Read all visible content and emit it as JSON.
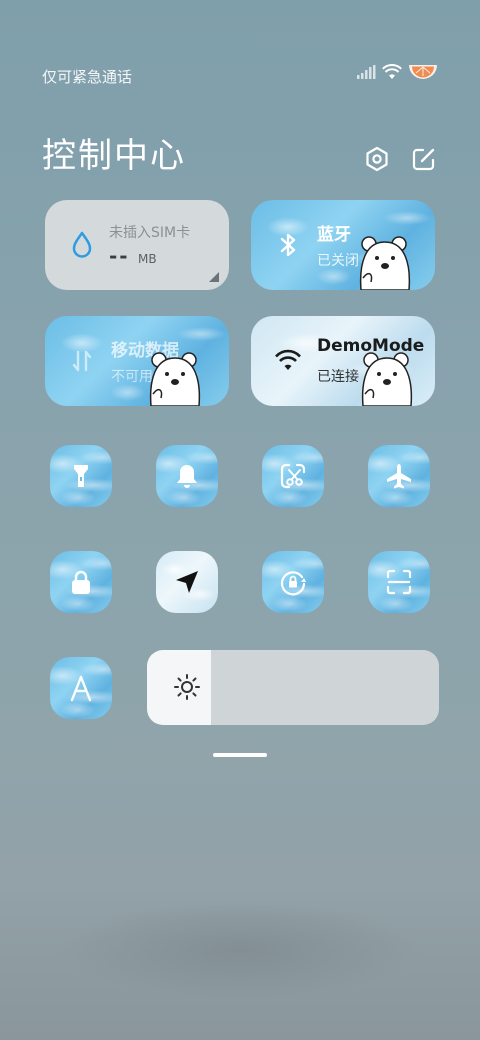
{
  "status": {
    "carrier_text": "仅可紧急通话",
    "icons": [
      "signal-icon",
      "wifi-icon",
      "battery-icon"
    ]
  },
  "header": {
    "title": "控制中心",
    "icons": [
      "settings-icon",
      "edit-icon"
    ]
  },
  "tiles": {
    "data_usage": {
      "label": "未插入SIM卡",
      "value": "--",
      "unit": "MB",
      "icon": "water-drop-icon"
    },
    "bluetooth": {
      "label": "蓝牙",
      "status": "已关闭",
      "icon": "bluetooth-icon"
    },
    "mobile_data": {
      "label": "移动数据",
      "status": "不可用",
      "icon": "mobile-data-icon"
    },
    "wifi": {
      "label": "DemoMode",
      "status": "已连接",
      "icon": "wifi-icon"
    }
  },
  "toggles": [
    {
      "name": "flashlight",
      "icon": "flashlight-icon"
    },
    {
      "name": "ringer",
      "icon": "bell-icon"
    },
    {
      "name": "screenshot",
      "icon": "screenshot-icon"
    },
    {
      "name": "airplane-mode",
      "icon": "airplane-icon"
    },
    {
      "name": "lock-screen",
      "icon": "lock-icon"
    },
    {
      "name": "location",
      "icon": "location-arrow-icon"
    },
    {
      "name": "rotation-lock",
      "icon": "rotation-lock-icon"
    },
    {
      "name": "scanner",
      "icon": "scan-icon"
    },
    {
      "name": "auto-brightness",
      "icon": "letter-a-icon"
    }
  ],
  "brightness": {
    "level": 0.22,
    "icon": "sun-icon"
  },
  "colors": {
    "accent": "#6bbde6",
    "tile_inactive": "#d4d9dc",
    "drop_icon": "#2f9be0"
  }
}
